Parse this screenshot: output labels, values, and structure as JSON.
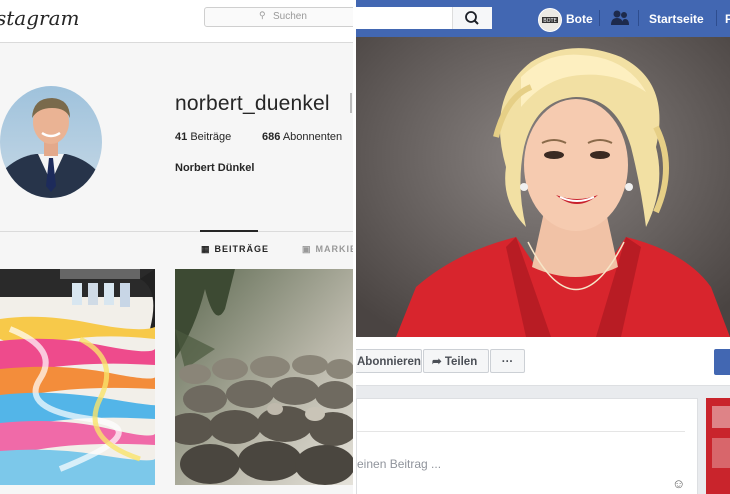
{
  "instagram": {
    "logo": "stagram",
    "search_placeholder": "Suchen",
    "username": "norbert_duenkel",
    "posts_count": "41",
    "posts_label": "Beiträge",
    "followers_count": "686",
    "followers_label": "Abonnenten",
    "full_name": "Norbert Dünkel",
    "tabs": [
      {
        "label": "BEITRÄGE",
        "icon": "grid-icon",
        "active": true
      },
      {
        "label": "MARKIE",
        "icon": "tag-icon",
        "active": false
      }
    ]
  },
  "facebook": {
    "profile_name": "Bote",
    "nav": [
      "Startseite",
      "F"
    ],
    "actions": {
      "subscribe": "Abonnieren",
      "share": "Teilen",
      "more": "···"
    },
    "composer_placeholder": "einen Beitrag ..."
  },
  "colors": {
    "fb_blue": "#4267b2",
    "ig_text": "#262626"
  }
}
